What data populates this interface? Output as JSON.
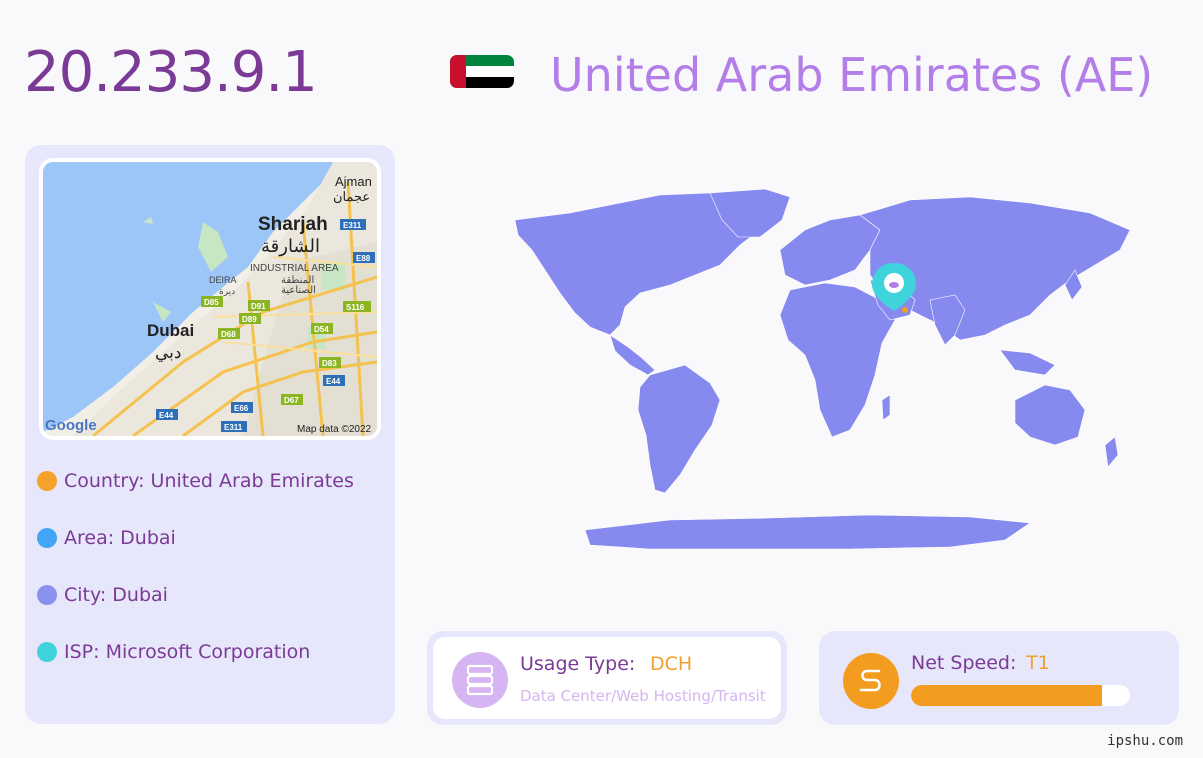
{
  "ip_address": "20.233.9.1",
  "country_title": "United Arab Emirates (AE)",
  "flag": {
    "colors": [
      "#c8102e",
      "#00843d",
      "#ffffff",
      "#000000"
    ]
  },
  "city_map": {
    "labels": {
      "ajman_en": "Ajman",
      "ajman_ar": "عجمان",
      "sharjah_en": "Sharjah",
      "sharjah_ar": "الشارقة",
      "industrial_en": "INDUSTRIAL AREA",
      "industrial_ar1": "المنطقة",
      "industrial_ar2": "الصناعية",
      "deira_en": "DEIRA",
      "deira_ar": "ديرة",
      "dubai_en": "Dubai",
      "dubai_ar": "دبي",
      "google": "Google",
      "map_data": "Map data ©2022"
    },
    "road_shields": [
      "E311",
      "E88",
      "D85",
      "D91",
      "D89",
      "D68",
      "S116",
      "D54",
      "D83",
      "E44",
      "D67",
      "E66",
      "E44",
      "E311"
    ]
  },
  "info": [
    {
      "label": "Country: United Arab Emirates",
      "color": "#f6a12b"
    },
    {
      "label": "Area: Dubai",
      "color": "#42a5f5"
    },
    {
      "label": "City: Dubai",
      "color": "#8a90ee"
    },
    {
      "label": "ISP: Microsoft Corporation",
      "color": "#3fd3dc"
    }
  ],
  "usage": {
    "label": "Usage Type:",
    "value": "DCH",
    "description": "Data Center/Web Hosting/Transit",
    "icon": "server-icon"
  },
  "speed": {
    "label": "Net Speed:",
    "value": "T1",
    "fill_fraction": 0.87,
    "icon": "speed-route-icon"
  },
  "watermark": "ipshu.com",
  "colors": {
    "accent": "#7b3a96",
    "map_land": "#8689ee",
    "pin": "#3fd3dc"
  }
}
